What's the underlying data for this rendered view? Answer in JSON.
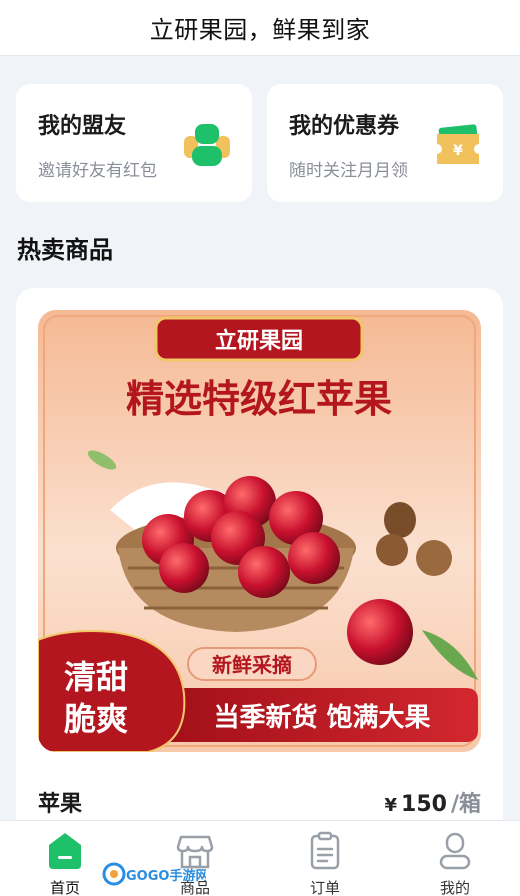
{
  "header": {
    "title": "立研果园，鲜果到家"
  },
  "cards": [
    {
      "title": "我的盟友",
      "subtitle": "邀请好友有红包",
      "icon": "allies-icon"
    },
    {
      "title": "我的优惠券",
      "subtitle": "随时关注月月领",
      "icon": "coupon-icon"
    }
  ],
  "section": {
    "title": "热卖商品"
  },
  "product": {
    "banner": {
      "shop_ribbon": "立研果园",
      "headline": "精选特级红苹果",
      "tag": "新鲜采摘",
      "badge_line1": "清甜",
      "badge_line2": "脆爽",
      "slogan": "当季新货 饱满大果"
    },
    "name": "苹果",
    "currency": "¥",
    "price": "150",
    "unit": "/箱"
  },
  "tabbar": {
    "active": "首页",
    "items": [
      {
        "label": "首页",
        "icon": "home-icon"
      },
      {
        "label": "商品",
        "icon": "store-icon"
      },
      {
        "label": "订单",
        "icon": "order-icon"
      },
      {
        "label": "我的",
        "icon": "profile-icon"
      }
    ]
  },
  "watermark": {
    "text": "GOGO手游网"
  },
  "colors": {
    "accent": "#1fc06a",
    "banner_red": "#b3161f",
    "gold": "#f1c15b"
  }
}
